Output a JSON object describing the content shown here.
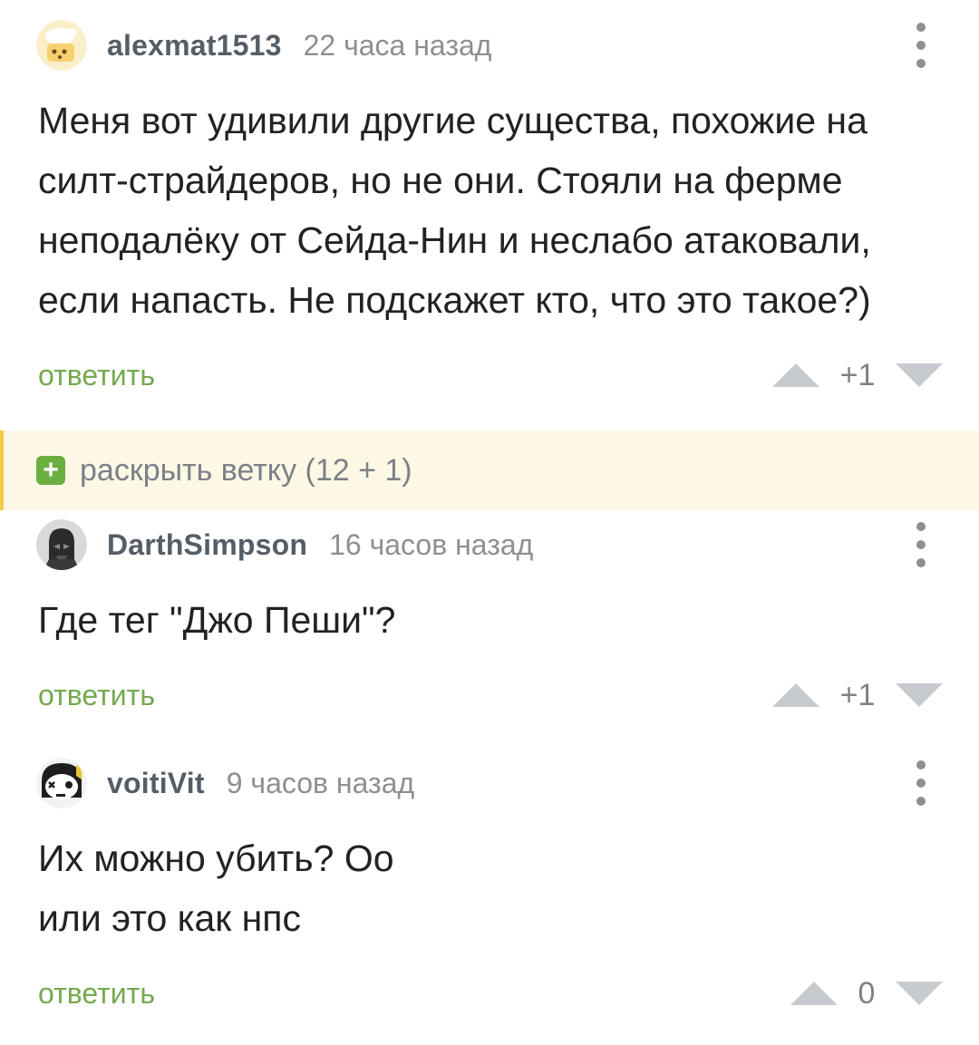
{
  "comments": [
    {
      "username": "alexmat1513",
      "time": "22 часа назад",
      "text_lines": [
        "Меня вот удивили другие существа, похожие на",
        "силт-страйдеров, но не они. Стояли на ферме",
        "неподалёку от Сейда-Нин и неслабо атаковали,",
        "если напасть. Не подскажет кто, что это такое?)"
      ],
      "reply_label": "ответить",
      "rating": "+1"
    },
    {
      "username": "DarthSimpson",
      "time": "16 часов назад",
      "text_lines": [
        "Где тег \"Джо Пеши\"?"
      ],
      "reply_label": "ответить",
      "rating": "+1"
    },
    {
      "username": "voitiVit",
      "time": "9 часов назад",
      "text_lines": [
        "Их можно убить? Оо",
        "или это как нпс"
      ],
      "reply_label": "ответить",
      "rating": "0"
    }
  ],
  "branch": {
    "plus_symbol": "+",
    "label": "раскрыть ветку (12 + 1)"
  },
  "colors": {
    "accent_green": "#74a94f",
    "branch_bg": "#fdf8e6",
    "branch_border": "#f2cc48",
    "meta_gray": "#8c8f93",
    "vote_arrow": "#c7cbd0"
  },
  "icons": {
    "more": "more-vertical-icon",
    "vote_up": "arrow-up-icon",
    "vote_down": "arrow-down-icon",
    "expand": "plus-square-icon"
  }
}
